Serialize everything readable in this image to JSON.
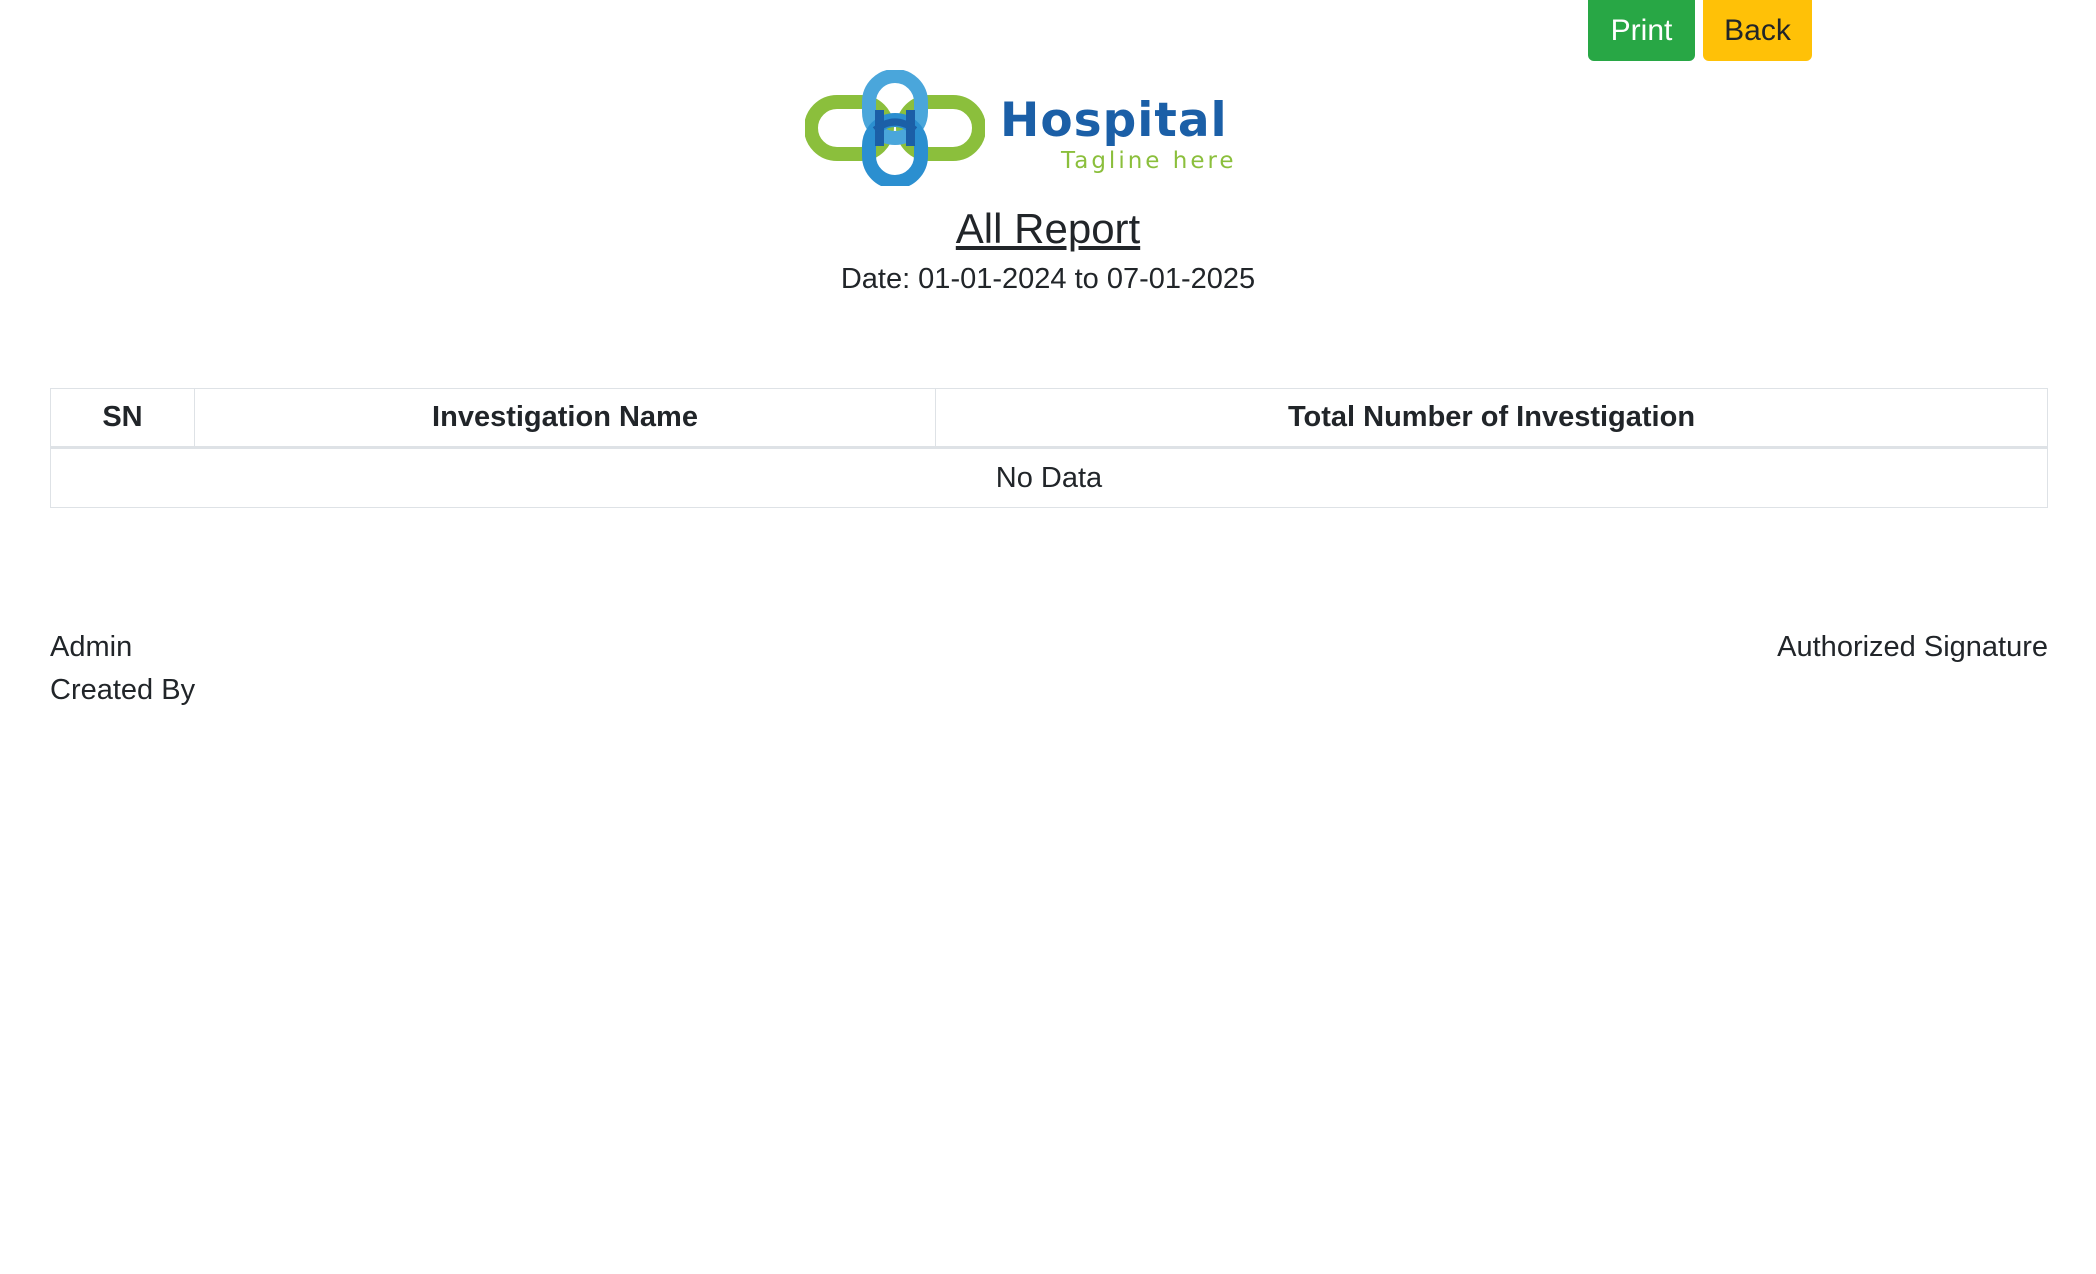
{
  "toolbar": {
    "print_label": "Print",
    "back_label": "Back",
    "print_color": "#28a745",
    "back_color": "#ffc107"
  },
  "logo": {
    "name": "Hospital",
    "tagline": "Tagline here",
    "brand_blue": "#1b5fa7",
    "brand_green": "#8bbf3c"
  },
  "report": {
    "title": "All Report",
    "date_range": "Date: 01-01-2024 to 07-01-2025"
  },
  "table": {
    "headers": {
      "sn": "SN",
      "name": "Investigation Name",
      "total": "Total Number of Investigation"
    },
    "empty_message": "No Data"
  },
  "footer": {
    "created_by_name": "Admin",
    "created_by_label": "Created By",
    "signature_label": "Authorized Signature"
  }
}
